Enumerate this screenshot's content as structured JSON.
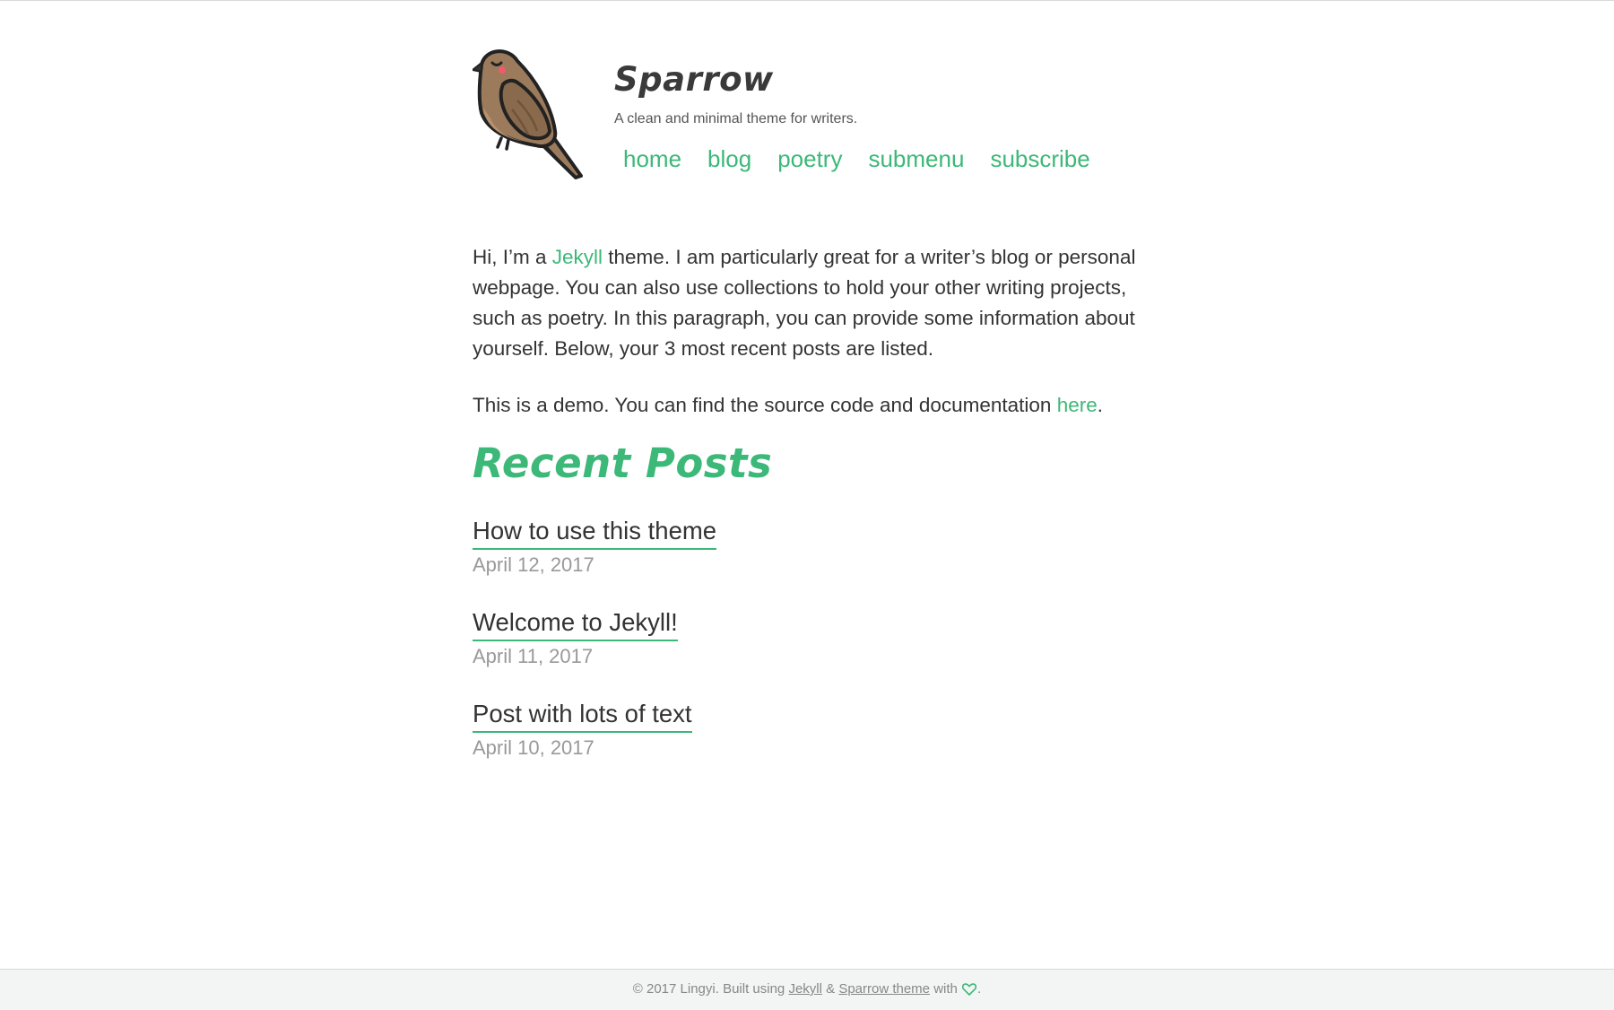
{
  "header": {
    "title": "Sparrow",
    "tagline": "A clean and minimal theme for writers.",
    "nav": [
      {
        "label": "home"
      },
      {
        "label": "blog"
      },
      {
        "label": "poetry"
      },
      {
        "label": "submenu"
      },
      {
        "label": "subscribe"
      }
    ]
  },
  "intro": {
    "p1_before": "Hi, I’m a ",
    "p1_link": "Jekyll",
    "p1_after": " theme. I am particularly great for a writer’s blog or personal webpage. You can also use collections to hold your other writing projects, such as poetry. In this paragraph, you can provide some information about yourself. Below, your 3 most recent posts are listed.",
    "p2_before": "This is a demo. You can find the source code and documentation ",
    "p2_link": "here",
    "p2_after": "."
  },
  "recent": {
    "heading": "Recent Posts",
    "posts": [
      {
        "title": "How to use this theme",
        "date": "April 12, 2017"
      },
      {
        "title": "Welcome to Jekyll!",
        "date": "April 11, 2017"
      },
      {
        "title": "Post with lots of text",
        "date": "April 10, 2017"
      }
    ]
  },
  "footer": {
    "prefix": "© 2017 Lingyi. Built using ",
    "link1": "Jekyll",
    "amp": " & ",
    "link2": "Sparrow theme",
    "with": " with ",
    "suffix": "."
  },
  "colors": {
    "accent": "#3cb878",
    "text": "#333333",
    "muted": "#999999",
    "footer_bg": "#f3f4f4"
  },
  "icons": {
    "logo": "sparrow-bird-logo",
    "footer_heart": "heart-outline-icon"
  }
}
